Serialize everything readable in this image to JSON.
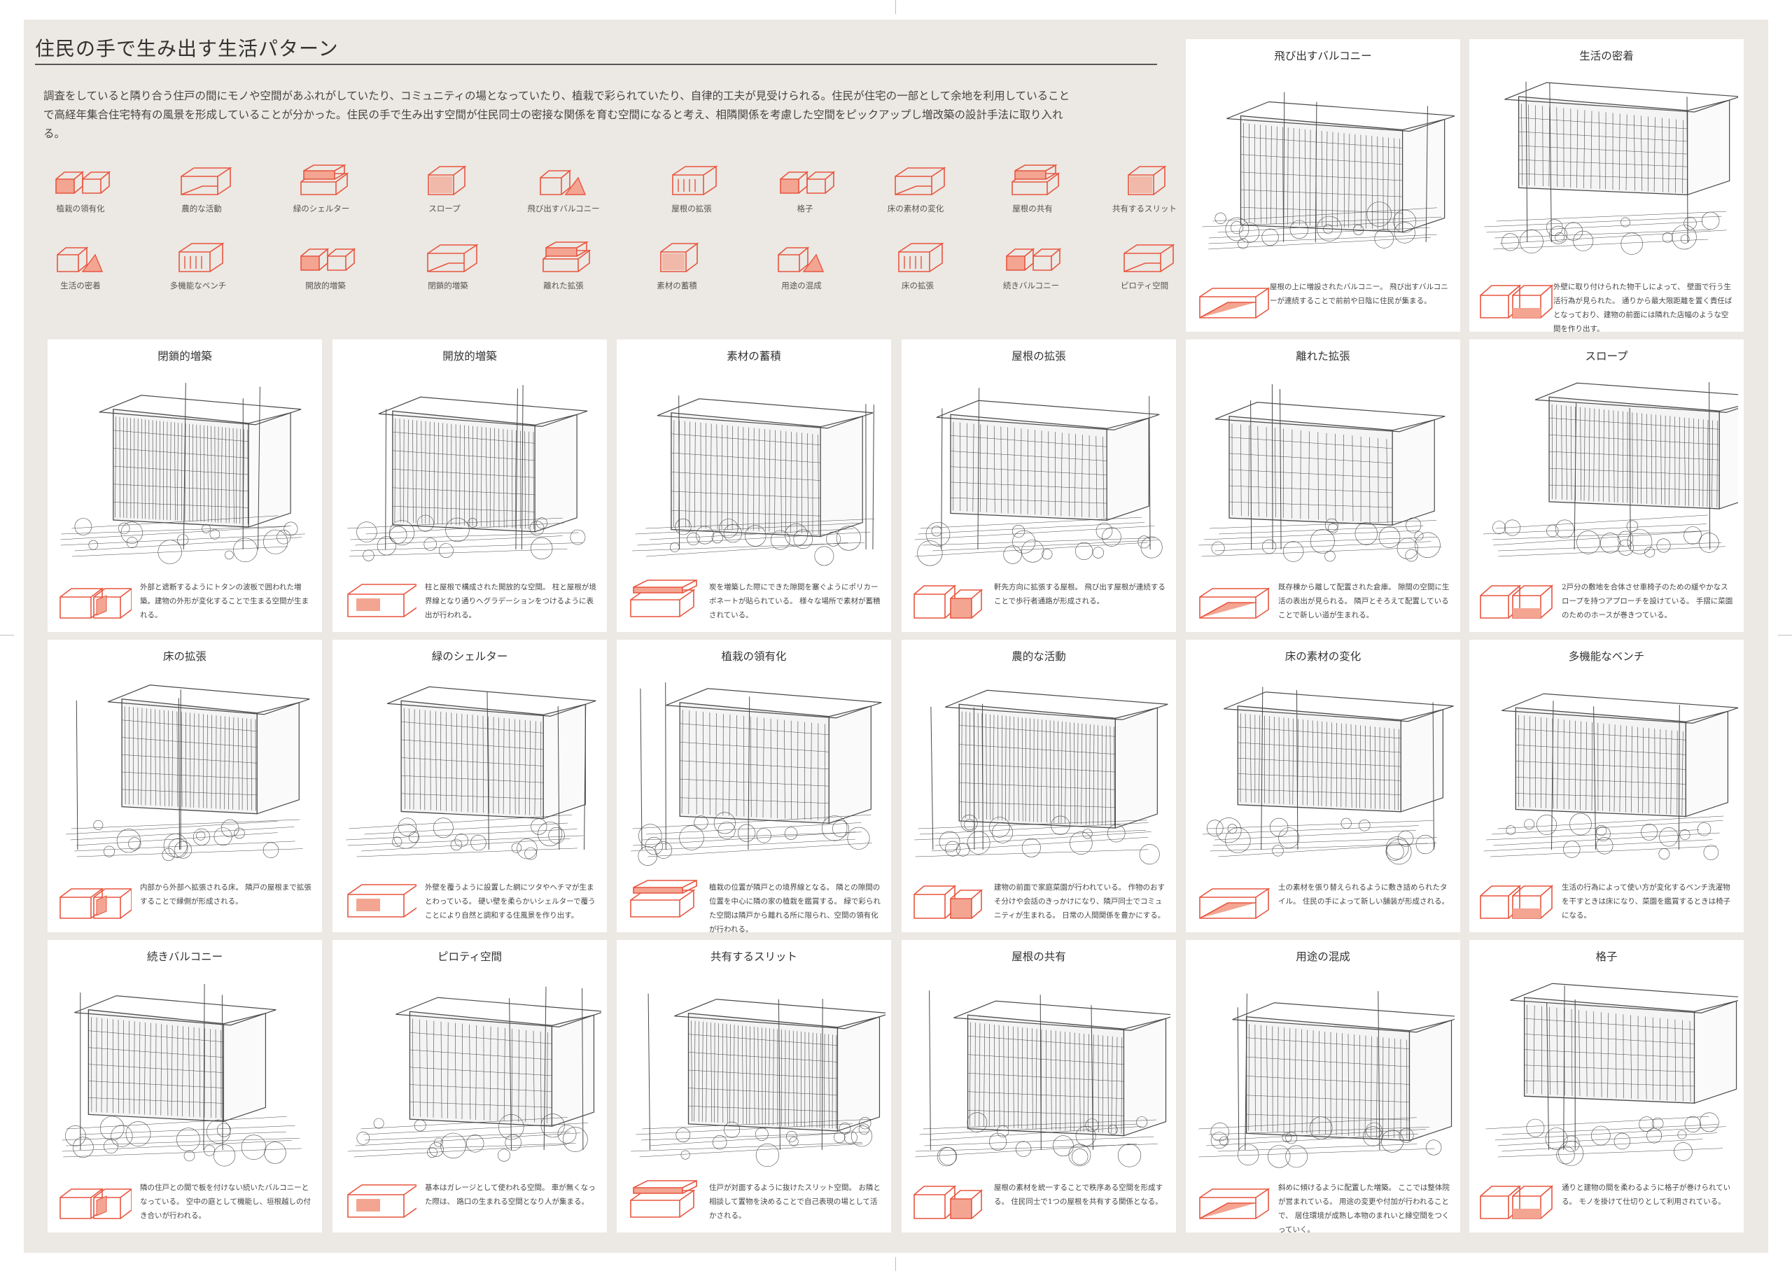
{
  "page": {
    "title": "住民の手で生み出す生活パターン",
    "intro": "調査をしていると隣り合う住戸の間にモノや空間があふれがしていたり、コミュニティの場となっていたり、植栽で彩られていたり、自律的工夫が見受けられる。住民が住宅の一部として余地を利用していることで高経年集合住宅特有の風景を形成していることが分かった。住民の手で生み出す空間が住民同士の密接な関係を育む空間になると考え、相隣関係を考慮した空間をピックアップし増改築の設計手法に取り入れる。"
  },
  "colors": {
    "accent": "#e8553f",
    "accent_fill": "#f3a592",
    "sheet": "#ece8e3",
    "card": "#ffffff",
    "line": "#4a4a4a"
  },
  "legend": [
    {
      "label": "植栽の領有化",
      "icon": "twin-box-icon"
    },
    {
      "label": "農的な活動",
      "icon": "twin-box-icon"
    },
    {
      "label": "緑のシェルター",
      "icon": "twin-box-icon"
    },
    {
      "label": "スロープ",
      "icon": "slope-box-icon"
    },
    {
      "label": "飛び出すバルコニー",
      "icon": "balcony-icon"
    },
    {
      "label": "屋根の拡張",
      "icon": "roof-icon"
    },
    {
      "label": "格子",
      "icon": "lattice-icon"
    },
    {
      "label": "床の素材の変化",
      "icon": "floor-icon"
    },
    {
      "label": "屋根の共有",
      "icon": "shared-roof-icon"
    },
    {
      "label": "共有するスリット",
      "icon": "slit-icon"
    },
    {
      "label": "生活の密着",
      "icon": "triangle-box-icon"
    },
    {
      "label": "多機能なベンチ",
      "icon": "bench-icon"
    },
    {
      "label": "開放的増築",
      "icon": "twin-box-icon"
    },
    {
      "label": "閉鎖的増築",
      "icon": "twin-box-icon"
    },
    {
      "label": "離れた拡張",
      "icon": "separate-box-icon"
    },
    {
      "label": "素材の蓄積",
      "icon": "material-icon"
    },
    {
      "label": "用途の混成",
      "icon": "mixed-use-icon"
    },
    {
      "label": "床の拡張",
      "icon": "floor-ext-icon"
    },
    {
      "label": "続きバルコニー",
      "icon": "cont-balcony-icon"
    },
    {
      "label": "ピロティ空間",
      "icon": "piloti-icon"
    }
  ],
  "cards_top": [
    {
      "title": "飛び出すバルコニー",
      "desc": "屋根の上に増設されたバルコニー。 飛び出すバルコニーが連続することで前前や日陰に住民が集まる。",
      "sketch": "balcony"
    },
    {
      "title": "生活の密着",
      "desc": "外壁に取り付けられた物干しによって、 壁面で行う生活行為が見られた。 通りから最大限距離を置く責任ばとなっており、建物の前面には隣れた店幅のような空間を作り出す。",
      "sketch": "laundry"
    }
  ],
  "cards": [
    {
      "title": "閉鎖的増築",
      "desc": "外部と遮断するようにトタンの波板で囲われた増築。建物の外形が変化することで生まる空間が生まれる。",
      "sketch": "shed-closed"
    },
    {
      "title": "開放的増築",
      "desc": "柱と屋根で構成された開放的な空間。 柱と屋根が境界線となり通りへグラデーションをつけるように表出が行われる。",
      "sketch": "open-extension"
    },
    {
      "title": "素材の蓄積",
      "desc": "炭を増築した際にできた隙間を塞ぐようにポリカーボネートが貼られている。 様々な場所で素材が蓄積されている。",
      "sketch": "material"
    },
    {
      "title": "屋根の拡張",
      "desc": "軒先方向に拡張する屋根。 飛び出す屋根が連続することで歩行者通路が形成される。",
      "sketch": "roof-ext"
    },
    {
      "title": "離れた拡張",
      "desc": "既存棟から離して配置された倉庫。 隙間の空間に生活の表出が見られる。 隣戸とそろえて配置していることで新しい道が生まれる。",
      "sketch": "storage"
    },
    {
      "title": "スロープ",
      "desc": "2戸分の敷地を合体させ車椅子のための緩やかなスロープを持つアプローチを設けている。 手摺に菜園のためのホースが巻きつている。",
      "sketch": "slope"
    },
    {
      "title": "床の拡張",
      "desc": "内部から外部へ拡張される床。 隣戸の屋根まで拡張することで縁側が形成される。",
      "sketch": "deck"
    },
    {
      "title": "緑のシェルター",
      "desc": "外壁を覆うように設置した網にツタやヘチマが生まとわっている。 硬い壁を柔らかいシェルターで覆うことにより自然と調和する住風景を作り出す。",
      "sketch": "green-shelter"
    },
    {
      "title": "植栽の領有化",
      "desc": "植栽の位置が隣戸との境界線となる。 隣との隙間の位置を中心に隣の家の植栽を鑑賞する。 緑で彩られた空間は隣戸から離れる所に限られ、空間の領有化が行われる。",
      "sketch": "garden"
    },
    {
      "title": "農的な活動",
      "desc": "建物の前面で家庭菜園が行われている。 作物のおすそ分けや会話のきっかけになり、隣戸同士でコミュニティが生まれる。 日常の人間関係を豊かにする。",
      "sketch": "farm"
    },
    {
      "title": "床の素材の変化",
      "desc": "土の素材を張り替えられるように敷き詰められたタイル。 住民の手によって新しい舗装が形成される。",
      "sketch": "tiles"
    },
    {
      "title": "多機能なベンチ",
      "desc": "生活の行為によって使い方が変化するベンチ洗濯物を干すときは床になり、菜園を鑑賞するときは椅子になる。",
      "sketch": "bench"
    },
    {
      "title": "続きバルコニー",
      "desc": "隣の住戸との間で板を付けない続いたバルコニーとなっている。 空中の庭として機能し、垣根越しの付き合いが行われる。",
      "sketch": "cont-balcony"
    },
    {
      "title": "ピロティ空間",
      "desc": "基本はガレージとして使われる空間。 車が無くなった際は、 路口の生まれる空間となり人が集まる。",
      "sketch": "piloti"
    },
    {
      "title": "共有するスリット",
      "desc": "住戸が対面するように抜けたスリット空間。 お隣と相談して置物を決めることで自己表現の場として活かされる。",
      "sketch": "slit"
    },
    {
      "title": "屋根の共有",
      "desc": "屋根の素材を統一することで秩序ある空間を形成する。 住民同士で1つの屋根を共有する関係となる。",
      "sketch": "shared-roof"
    },
    {
      "title": "用途の混成",
      "desc": "斜めに傾けるように配置した増築。 ここでは整体院が営まれている。 用途の変更や付加が行われることで、 居住環境が成熟し本物のまれいと縁空間をつくっていく。",
      "sketch": "mixed"
    },
    {
      "title": "格子",
      "desc": "通りと建物の間を柔わるように格子が巻けられている。 モノを掛けて仕切りとして利用されている。",
      "sketch": "lattice"
    }
  ]
}
